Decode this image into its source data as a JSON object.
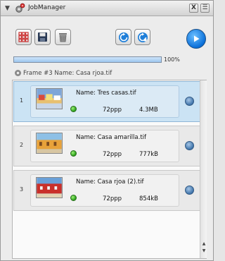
{
  "window": {
    "title": "JobManager",
    "close_label": "X",
    "menu_label": "☰"
  },
  "toolbar": {
    "items": [
      {
        "name": "grid-icon"
      },
      {
        "name": "save-icon"
      },
      {
        "name": "trash-icon"
      },
      {
        "name": "refresh-icon"
      },
      {
        "name": "refresh-alt-icon"
      }
    ],
    "play_icon": "play-icon"
  },
  "progress": {
    "value": 1.0,
    "label": "100%"
  },
  "current": {
    "text": "Frame #3 Name: Casa rjoa.tif"
  },
  "jobs": [
    {
      "index": "1",
      "name": "Name: Tres casas.tif",
      "resolution": "72ppp",
      "size": "4.3MB",
      "status_color": "#2fa51d",
      "selected": true
    },
    {
      "index": "2",
      "name": "Name: Casa amarilla.tif",
      "resolution": "72ppp",
      "size": "777kB",
      "status_color": "#2fa51d",
      "selected": false
    },
    {
      "index": "3",
      "name": "Name: Casa rjoa (2).tif",
      "resolution": "72ppp",
      "size": "854kB",
      "status_color": "#2fa51d",
      "selected": false
    }
  ],
  "colors": {
    "accent": "#0a6fd9",
    "selected_row": "#cbe3f4"
  }
}
